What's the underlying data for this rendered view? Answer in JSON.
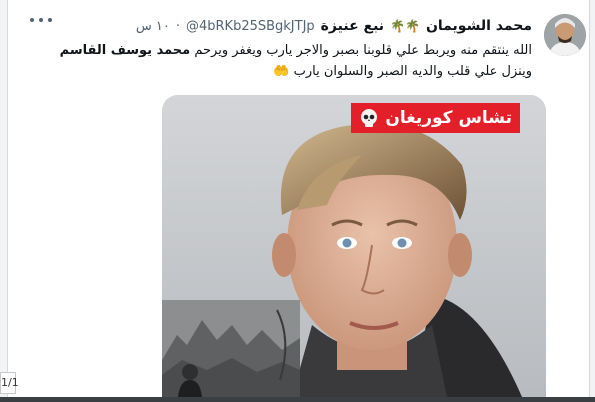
{
  "tweet": {
    "display_name": "محمد الشويمان",
    "name_emoji": "🌴🌴",
    "location_tag": "نبع عنيزة",
    "handle": "@4bRKb25SBgkJTJp",
    "separator": "·",
    "time": "١٠ س",
    "more_icon": "ellipsis-icon",
    "text_line1": "الله ينتقم منه ويربط علي قلوبنا بصبر والاجر يارب ويغفر ويرحم ",
    "text_bold_name": "محمد يوسف القاسم",
    "text_line2": "وينزل علي قلب والديه الصبر والسلوان يارب",
    "text_emoji": "🤲"
  },
  "media": {
    "tag_text": "تشاس كوريغان",
    "tag_icon": "skull-icon",
    "tag_color": "#e3202a"
  },
  "page_counter": "1/1"
}
